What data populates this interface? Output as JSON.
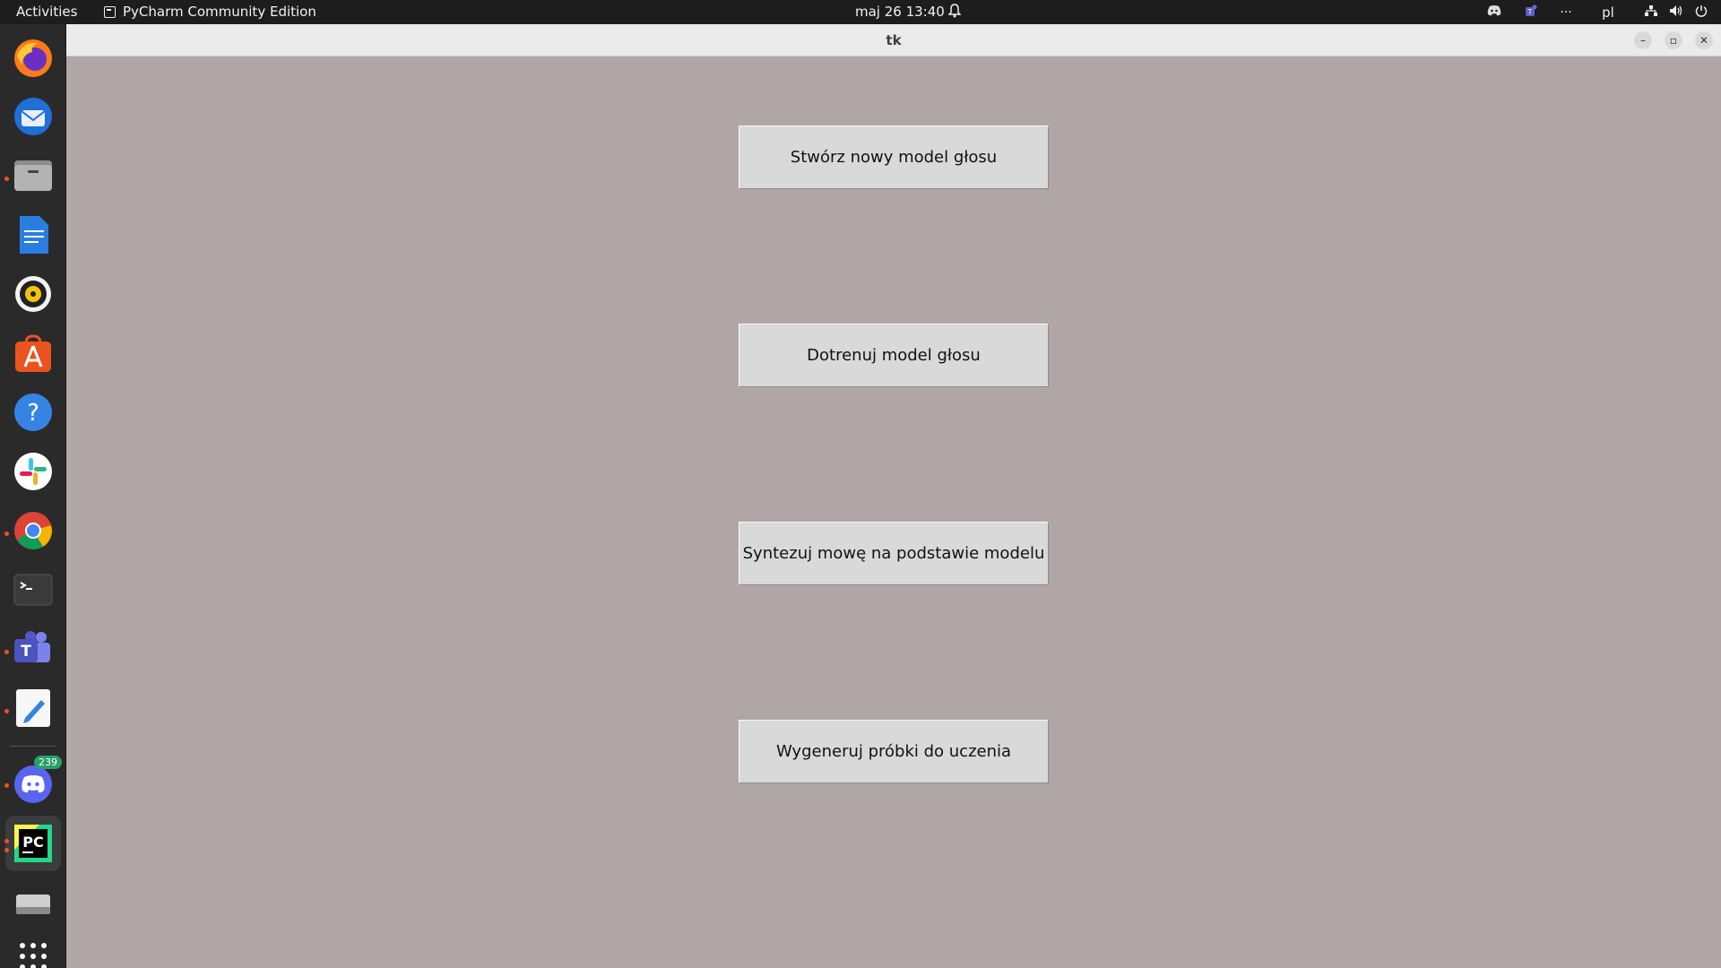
{
  "topbar": {
    "activities": "Activities",
    "app_name": "PyCharm Community Edition",
    "clock": "maj 26  13:40",
    "keyboard_layout": "pl",
    "overflow": "···"
  },
  "dock": {
    "discord_badge": "239"
  },
  "window": {
    "title": "tk",
    "buttons": [
      {
        "label": "Stwórz nowy model głosu"
      },
      {
        "label": "Dotrenuj model głosu"
      },
      {
        "label": "Syntezuj mowę na podstawie modelu"
      },
      {
        "label": "Wygeneruj próbki do uczenia"
      }
    ]
  },
  "colors": {
    "client_background": "#b0a6a6",
    "button_face": "#d9d9d9",
    "topbar": "#1d1d1d",
    "dock": "#2a2a2a"
  }
}
